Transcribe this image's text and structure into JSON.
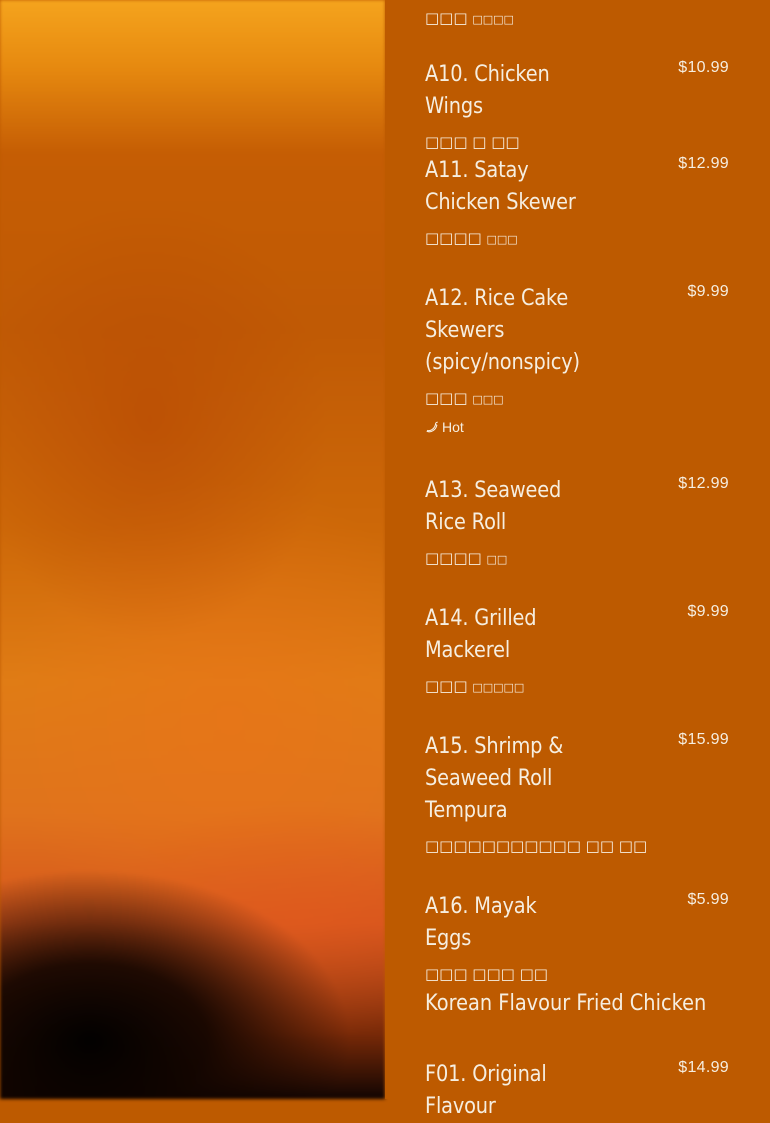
{
  "top_description": {
    "main": "□□□",
    "small": "□□□□"
  },
  "items": [
    {
      "name": "A10. Chicken Wings",
      "price": "$10.99",
      "desc_main": "□□□ □ □□",
      "desc_small": ""
    },
    {
      "name": "A11. Satay Chicken Skewer",
      "price": "$12.99",
      "desc_main": "□□□□",
      "desc_small": "□□□"
    },
    {
      "name": "A12. Rice Cake Skewers (spicy/nonspicy)",
      "price": "$9.99",
      "desc_main": "□□□",
      "desc_small": "□□□",
      "tag": "Hot"
    },
    {
      "name": "A13. Seaweed Rice Roll",
      "price": "$12.99",
      "desc_main": "□□□□",
      "desc_small": "□□"
    },
    {
      "name": "A14. Grilled Mackerel",
      "price": "$9.99",
      "desc_main": "□□□",
      "desc_small": "□□□□□"
    },
    {
      "name": "A15. Shrimp & Seaweed Roll Tempura",
      "price": "$15.99",
      "desc_main": "□□□□□□□□□□□ □□ □□",
      "desc_small": ""
    },
    {
      "name": "A16. Mayak Eggs",
      "price": "$5.99",
      "desc_main": "□□□ □□□ □□",
      "desc_small": ""
    }
  ],
  "section_title": "Korean Flavour Fried Chicken",
  "last_item": {
    "name": "F01. Original Flavour",
    "price": "$14.99"
  },
  "colors": {
    "panel_bg": "#bd5a00",
    "text": "#f6eee0"
  },
  "icons": {
    "hot": "chili-pepper-icon"
  }
}
